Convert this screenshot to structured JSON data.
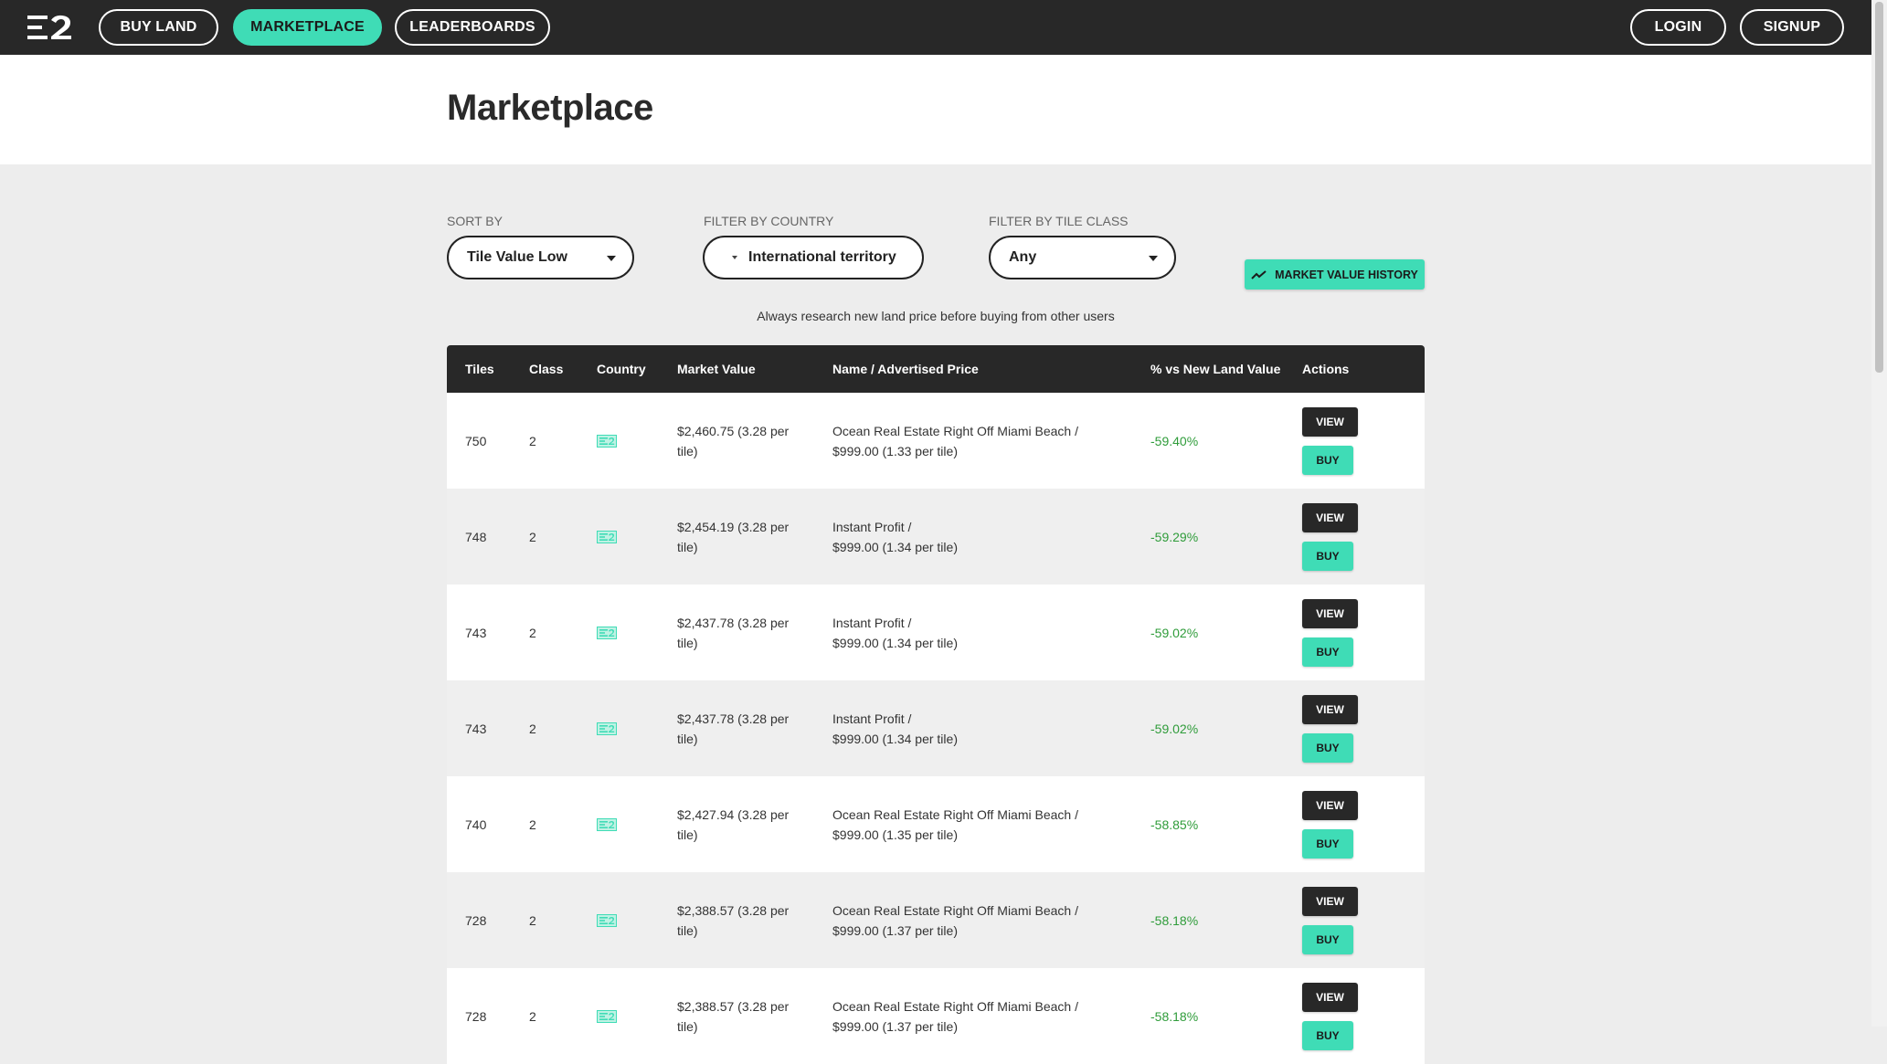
{
  "nav": {
    "buy_land": "BUY LAND",
    "marketplace": "MARKETPLACE",
    "leaderboards": "LEADERBOARDS",
    "login": "LOGIN",
    "signup": "SIGNUP",
    "logo_icon": "e2-logo-icon"
  },
  "page": {
    "title": "Marketplace",
    "notice": "Always research new land price before buying from other users"
  },
  "filters": {
    "sort_label": "SORT BY",
    "sort_value": "Tile Value Low",
    "country_label": "FILTER BY COUNTRY",
    "country_value": "International territory",
    "class_label": "FILTER BY TILE CLASS",
    "class_value": "Any",
    "history_button": "MARKET VALUE HISTORY",
    "history_icon": "trending-up-icon"
  },
  "table": {
    "headers": {
      "tiles": "Tiles",
      "class": "Class",
      "country": "Country",
      "market_value": "Market Value",
      "name_price": "Name / Advertised Price",
      "pct": "% vs New Land Value",
      "actions": "Actions"
    },
    "view_label": "VIEW",
    "buy_label": "BUY",
    "rows": [
      {
        "tiles": "750",
        "class": "2",
        "mv_line1": "$2,460.75 (3.28 per",
        "mv_line2": "tile)",
        "name_line1": "Ocean Real Estate Right Off Miami Beach /",
        "name_line2": "$999.00 (1.33 per tile)",
        "pct": "-59.40%"
      },
      {
        "tiles": "748",
        "class": "2",
        "mv_line1": "$2,454.19 (3.28 per",
        "mv_line2": "tile)",
        "name_line1": "Instant Profit /",
        "name_line2": "$999.00 (1.34 per tile)",
        "pct": "-59.29%"
      },
      {
        "tiles": "743",
        "class": "2",
        "mv_line1": "$2,437.78 (3.28 per",
        "mv_line2": "tile)",
        "name_line1": "Instant Profit /",
        "name_line2": "$999.00 (1.34 per tile)",
        "pct": "-59.02%"
      },
      {
        "tiles": "743",
        "class": "2",
        "mv_line1": "$2,437.78 (3.28 per",
        "mv_line2": "tile)",
        "name_line1": "Instant Profit /",
        "name_line2": "$999.00 (1.34 per tile)",
        "pct": "-59.02%"
      },
      {
        "tiles": "740",
        "class": "2",
        "mv_line1": "$2,427.94 (3.28 per",
        "mv_line2": "tile)",
        "name_line1": "Ocean Real Estate Right Off Miami Beach /",
        "name_line2": "$999.00 (1.35 per tile)",
        "pct": "-58.85%"
      },
      {
        "tiles": "728",
        "class": "2",
        "mv_line1": "$2,388.57 (3.28 per",
        "mv_line2": "tile)",
        "name_line1": "Ocean Real Estate Right Off Miami Beach /",
        "name_line2": "$999.00 (1.37 per tile)",
        "pct": "-58.18%"
      },
      {
        "tiles": "728",
        "class": "2",
        "mv_line1": "$2,388.57 (3.28 per",
        "mv_line2": "tile)",
        "name_line1": "Ocean Real Estate Right Off Miami Beach /",
        "name_line2": "$999.00 (1.37 per tile)",
        "pct": "-58.18%"
      }
    ],
    "country_flag_icon": "international-territory-flag-icon"
  },
  "colors": {
    "accent": "#3fdcb6",
    "dark": "#282828",
    "positive_pct": "#2f9c3a",
    "page_bg": "#ededed"
  }
}
